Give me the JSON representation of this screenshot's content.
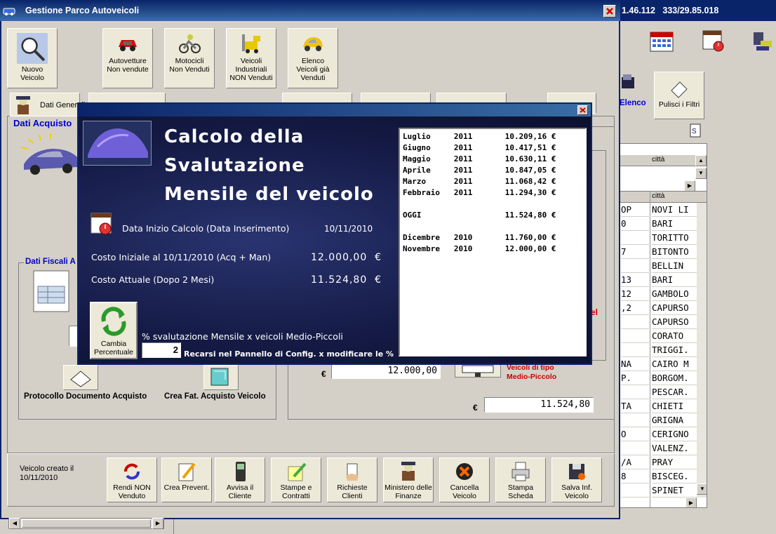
{
  "background_app": {
    "header_phone": "1.46.112   333/29.85.018",
    "filter_buttons": {
      "elenco": "Elenco",
      "pulisci": "Pulisci i Filtri"
    },
    "grid_header": "città",
    "grid_left_cells": [
      "OP",
      "0",
      "",
      "7",
      "",
      "13",
      "12",
      ",2",
      "",
      "",
      "",
      "NA",
      "P.",
      "",
      "TA",
      "",
      "O",
      "",
      "/A",
      "8",
      ""
    ],
    "grid_cities": [
      "NOVI LI",
      "BARI",
      "TORITTO",
      "BITONTO",
      "BELLIN",
      "BARI",
      "GAMBOLO",
      "CAPURSO",
      "CAPURSO",
      "CORATO",
      "TRIGGI.",
      "CAIRO M",
      "BORGOM.",
      "PESCAR.",
      "CHIETI",
      "GRIGNA",
      "CERIGNO",
      "VALENZ.",
      "PRAY",
      "BISCEG.",
      "SPINET"
    ]
  },
  "window": {
    "title": "Gestione Parco Autoveicoli",
    "toolbar": [
      {
        "label": "Nuovo Veicolo",
        "icon": "magnifier-icon"
      },
      {
        "label": "Autovetture Non vendute",
        "icon": "red-car-icon"
      },
      {
        "label": "Motocicli Non Venduti",
        "icon": "motorcycle-icon"
      },
      {
        "label": "Veicoli Industriali NON Venduti",
        "icon": "forklift-icon"
      },
      {
        "label": "Elenco Veicoli già Venduti",
        "icon": "yellow-car-icon"
      }
    ],
    "tab_first": "Dati Generali",
    "section_title": "Dati Acquisto",
    "fiscal_title": "Dati Fiscali A",
    "protocol_label": "Protocollo Documento Acquisto",
    "invoice_label": "Crea Fat. Acquisto Veicolo",
    "cost_value_1": "12.000,00",
    "cost_value_2": "11.524,80",
    "euro_symbol": "€",
    "vehicle_type_note": "Veicoli di tipo Medio-Piccolo",
    "red_fragment": "el",
    "created_info": "Veicolo creato il 10/11/2010",
    "bottom_buttons": [
      {
        "label": "Rendi NON Venduto",
        "icon": "refresh-icon"
      },
      {
        "label": "Crea Prevent.",
        "icon": "notepad-pencil-icon"
      },
      {
        "label": "Avvisa il Cliente",
        "icon": "mobile-phone-icon"
      },
      {
        "label": "Stampe e Contratti",
        "icon": "document-pencil-icon"
      },
      {
        "label": "Richieste Clienti",
        "icon": "hand-papers-icon"
      },
      {
        "label": "Ministero delle Finanze",
        "icon": "person-icon"
      },
      {
        "label": "Cancella Veicolo",
        "icon": "cancel-icon"
      },
      {
        "label": "Stampa Scheda",
        "icon": "printer-icon"
      },
      {
        "label": "Salva Inf. Veicolo",
        "icon": "save-icon"
      }
    ]
  },
  "popup": {
    "title_line1": "Calcolo della",
    "title_line2": "Svalutazione",
    "title_line3": "Mensile del veicolo",
    "start_label": "Data Inizio Calcolo (Data Inserimento)",
    "start_date": "10/11/2010",
    "initial_cost_label": "Costo Iniziale al 10/11/2010 (Acq + Man)",
    "initial_cost_value": "12.000,00  €",
    "current_cost_label": "Costo Attuale (Dopo 2 Mesi)",
    "current_cost_value": "11.524,80  €",
    "change_button": "Cambia Percentuale",
    "percent_label": "% svalutazione Mensile x veicoli Medio-Piccoli",
    "percent_value": "2",
    "config_note": "Recarsi nel Pannello di Config. x modificare le %",
    "list_rows": [
      "Luglio     2011       10.209,16 €",
      "Giugno     2011       10.417,51 €",
      "Maggio     2011       10.630,11 €",
      "Aprile     2011       10.847,05 €",
      "Marzo      2011       11.068,42 €",
      "Febbraio   2011       11.294,30 €",
      "",
      "OGGI                  11.524,80 €",
      "",
      "Dicembre   2010       11.760,00 €",
      "Novembre   2010       12.000,00 €"
    ]
  },
  "colors": {
    "title_bar": "#0a246a",
    "popup_bg": "#1a1f4a",
    "accent_red": "#cc0000",
    "accent_blue": "#0000cc"
  }
}
